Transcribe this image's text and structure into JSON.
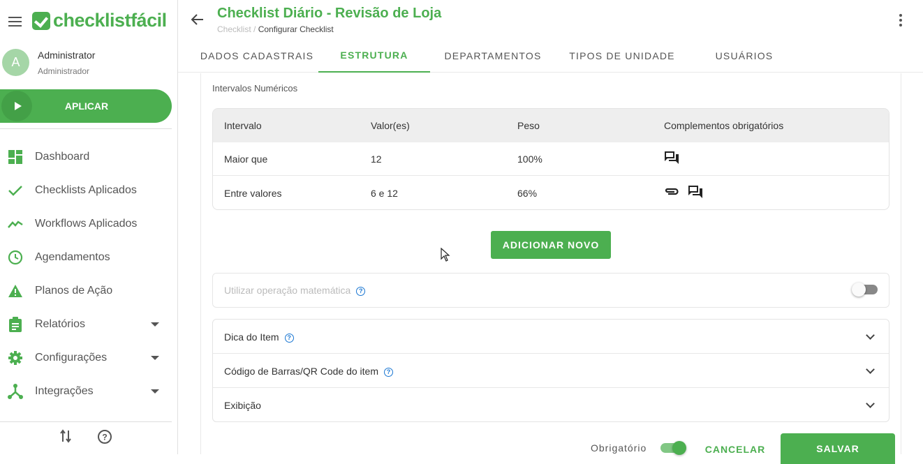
{
  "sidebar": {
    "logo_text": "checklistfácil",
    "user": {
      "initial": "A",
      "name": "Administrator",
      "role": "Administrador"
    },
    "apply_label": "APLICAR",
    "items": [
      {
        "label": "Dashboard",
        "icon": "dashboard-icon"
      },
      {
        "label": "Checklists Aplicados",
        "icon": "check-icon"
      },
      {
        "label": "Workflows Aplicados",
        "icon": "trending-icon"
      },
      {
        "label": "Agendamentos",
        "icon": "clock-icon"
      },
      {
        "label": "Planos de Ação",
        "icon": "warning-icon"
      },
      {
        "label": "Relatórios",
        "icon": "clipboard-icon",
        "has_submenu": true
      },
      {
        "label": "Configurações",
        "icon": "gear-icon",
        "has_submenu": true
      },
      {
        "label": "Integrações",
        "icon": "share-icon",
        "has_submenu": true
      }
    ],
    "bottom_icons": [
      "swap-vertical-icon",
      "help-icon"
    ]
  },
  "header": {
    "title": "Checklist Diário - Revisão de Loja",
    "breadcrumb_root": "Checklist",
    "breadcrumb_sep": "/",
    "breadcrumb_current": "Configurar Checklist"
  },
  "tabs": [
    {
      "label": "DADOS CADASTRAIS",
      "active": false
    },
    {
      "label": "ESTRUTURA",
      "active": true
    },
    {
      "label": "DEPARTAMENTOS",
      "active": false
    },
    {
      "label": "TIPOS DE UNIDADE",
      "active": false
    },
    {
      "label": "USUÁRIOS",
      "active": false
    }
  ],
  "intervals": {
    "section_title": "Intervalos Numéricos",
    "headers": [
      "Intervalo",
      "Valor(es)",
      "Peso",
      "Complementos obrigatórios"
    ],
    "rows": [
      {
        "interval": "Maior que",
        "values": "12",
        "weight": "100%",
        "complements": [
          "comment-icon"
        ]
      },
      {
        "interval": "Entre valores",
        "values": "6 e 12",
        "weight": "66%",
        "complements": [
          "attachment-icon",
          "comment-icon"
        ]
      }
    ],
    "add_button": "ADICIONAR NOVO"
  },
  "math": {
    "label": "Utilizar operação matemática",
    "enabled": false
  },
  "accordion": [
    {
      "label": "Dica do Item",
      "has_help": true
    },
    {
      "label": "Código de Barras/QR Code do item",
      "has_help": true
    },
    {
      "label": "Exibição",
      "has_help": false
    }
  ],
  "footer": {
    "required_label": "Obrigatório",
    "required_on": true,
    "cancel_label": "CANCELAR",
    "save_label": "SALVAR"
  },
  "colors": {
    "accent": "#4caf50",
    "help": "#1976d2"
  }
}
